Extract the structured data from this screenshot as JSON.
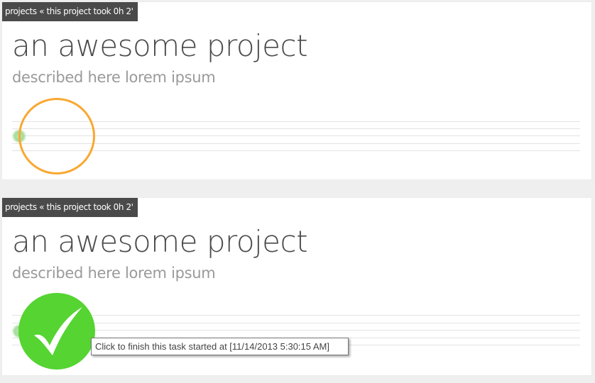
{
  "projects": [
    {
      "breadcrumb": "projects « this project took 0h 2'",
      "title": "an awesome project",
      "description": "described here lorem ipsum",
      "task_control": {
        "state": "in-progress",
        "icon": "progress-ring-icon"
      }
    },
    {
      "breadcrumb": "projects « this project took 0h 2'",
      "title": "an awesome project",
      "description": "described here lorem ipsum",
      "task_control": {
        "state": "finish",
        "icon": "checkmark-icon"
      }
    }
  ],
  "tooltip": {
    "text": "Click to finish this task started at [11/14/2013 5:30:15 AM]"
  },
  "colors": {
    "breadcrumb_bg": "#4a4a4a",
    "ring": "#f9a832",
    "check": "#55d432",
    "marker": "#a5dc9a"
  }
}
